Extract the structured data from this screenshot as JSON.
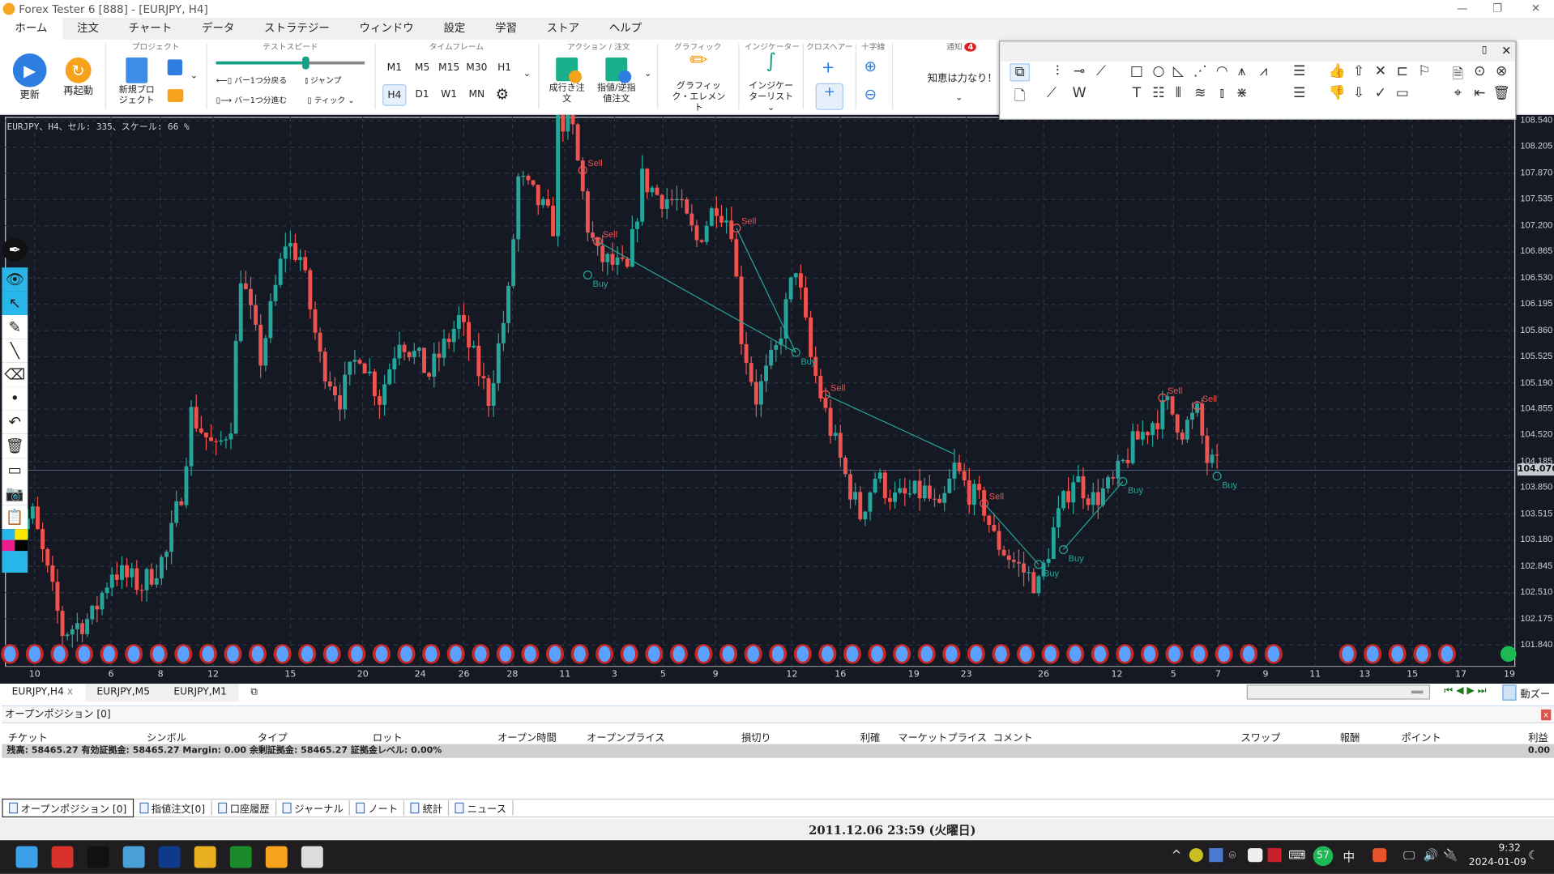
{
  "window": {
    "title": "Forex Tester 6  [888] - [EURJPY, H4]"
  },
  "menu": [
    "ホーム",
    "注文",
    "チャート",
    "データ",
    "ストラテジー",
    "ウィンドウ",
    "設定",
    "学習",
    "ストア",
    "ヘルプ"
  ],
  "ribbon": {
    "refresh": "更新",
    "restart": "再起動",
    "project_group": "プロジェクト",
    "new_project": "新規プロジェクト",
    "speed_group": "テストスピード",
    "speed_value": 0.6,
    "bar_back": "バー1つ分戻る",
    "bar_forward": "バー1つ分進む",
    "jump": "ジャンプ",
    "tick": "ティック",
    "timeframe_group": "タイムフレーム",
    "timeframes": [
      "M1",
      "M5",
      "M15",
      "M30",
      "H1",
      "H4",
      "D1",
      "W1",
      "MN"
    ],
    "selected_timeframe": "H4",
    "action_group": "アクション / 注文",
    "market_order": "成行き注文",
    "limit_order": "指値/逆指値注文",
    "graphic_group": "グラフィック",
    "graphic_elements": "グラフィック・エレメント",
    "indicator_group": "インジケーター",
    "indicator_list": "インジケーターリスト",
    "crosshair_group": "クロスヘアー",
    "cross_group": "十字線",
    "notify_group": "通知",
    "notify_count": "4",
    "notify_message": "知恵は力なり！"
  },
  "drawing_toolbar": {
    "icons": [
      "select-icon",
      "vertical-line-icon",
      "horizontal-line-icon",
      "trend-line-icon",
      "rectangle-icon",
      "ellipse-icon",
      "triangle-icon",
      "fibo-fan-icon",
      "fibo-arc-icon",
      "andrews-pitchfork-icon",
      "zigzag-icon",
      "channel-up-icon",
      "thumbs-up-icon",
      "arrow-up-icon",
      "cross-icon",
      "price-label-icon",
      "flag-icon",
      "template-icon",
      "target-icon",
      "target-x-icon",
      "page-icon",
      "ray-icon",
      "wave-icon",
      "text-icon",
      "parallel-lines-icon",
      "time-lines-icon",
      "fibo-icon",
      "candle-tool-icon",
      "gann-icon",
      "channel-down-icon",
      "thumbs-down-icon",
      "arrow-down-icon",
      "check-icon",
      "price-tag-icon",
      "remove-target-icon",
      "export-icon",
      "trash-icon"
    ]
  },
  "chart": {
    "info": "EURJPY、H4、セル: 335、スケール: 66 %",
    "current_price": "104.076"
  },
  "chart_data": {
    "type": "candlestick",
    "symbol": "EURJPY",
    "timeframe": "H4",
    "ylim": [
      101.7,
      108.6
    ],
    "price_ticks": [
      "108.540",
      "108.205",
      "107.870",
      "107.535",
      "107.200",
      "106.865",
      "106.530",
      "106.195",
      "105.860",
      "105.525",
      "105.190",
      "104.855",
      "104.520",
      "104.185",
      "103.850",
      "103.515",
      "103.180",
      "102.845",
      "102.510",
      "102.175",
      "101.840"
    ],
    "date_ticks": [
      "10",
      "6",
      "8",
      "12",
      "15",
      "20",
      "24",
      "26",
      "28",
      "11",
      "3",
      "5",
      "9",
      "12",
      "16",
      "19",
      "23",
      "26",
      "12",
      "5",
      "7",
      "9",
      "11",
      "13",
      "15",
      "17",
      "19"
    ],
    "close_path_bar_price": [
      [
        0,
        103.2
      ],
      [
        5,
        103.5
      ],
      [
        11,
        102.0
      ],
      [
        17,
        102.2
      ],
      [
        21,
        102.8
      ],
      [
        27,
        102.6
      ],
      [
        32,
        103.0
      ],
      [
        35,
        103.8
      ],
      [
        37,
        104.8
      ],
      [
        42,
        104.3
      ],
      [
        45,
        104.7
      ],
      [
        47,
        106.6
      ],
      [
        51,
        105.5
      ],
      [
        56,
        107.0
      ],
      [
        59,
        106.8
      ],
      [
        63,
        105.5
      ],
      [
        67,
        105.0
      ],
      [
        71,
        105.6
      ],
      [
        75,
        105.0
      ],
      [
        79,
        105.8
      ],
      [
        85,
        105.3
      ],
      [
        91,
        106.0
      ],
      [
        97,
        105.0
      ],
      [
        101,
        106.3
      ],
      [
        103,
        107.8
      ],
      [
        107,
        107.5
      ],
      [
        110,
        107.2
      ],
      [
        111,
        108.6
      ],
      [
        114,
        108.4
      ],
      [
        117,
        107.2
      ],
      [
        119,
        106.8
      ],
      [
        125,
        106.6
      ],
      [
        128,
        107.8
      ],
      [
        131,
        107.6
      ],
      [
        135,
        107.5
      ],
      [
        139,
        107.0
      ],
      [
        143,
        107.5
      ],
      [
        146,
        107.2
      ],
      [
        148,
        105.8
      ],
      [
        151,
        105.0
      ],
      [
        155,
        105.6
      ],
      [
        159,
        106.7
      ],
      [
        162,
        105.5
      ],
      [
        165,
        104.8
      ],
      [
        169,
        104.0
      ],
      [
        172,
        103.5
      ],
      [
        175,
        104.0
      ],
      [
        179,
        103.7
      ],
      [
        185,
        103.8
      ],
      [
        188,
        103.5
      ],
      [
        191,
        104.1
      ],
      [
        194,
        103.8
      ],
      [
        197,
        103.6
      ],
      [
        199,
        103.2
      ],
      [
        203,
        102.9
      ],
      [
        208,
        102.6
      ],
      [
        211,
        103.3
      ],
      [
        215,
        104.0
      ],
      [
        219,
        103.7
      ],
      [
        223,
        103.9
      ],
      [
        227,
        104.4
      ],
      [
        231,
        104.7
      ],
      [
        234,
        104.9
      ],
      [
        237,
        104.6
      ],
      [
        240,
        104.8
      ],
      [
        242,
        104.2
      ],
      [
        244,
        104.1
      ]
    ],
    "trades": [
      {
        "label": "Sell",
        "bar": 116,
        "price": 107.91
      },
      {
        "label": "Sell",
        "bar": 119,
        "price": 107.0
      },
      {
        "label": "Buy",
        "bar": 117,
        "price": 106.57
      },
      {
        "label": "Sell",
        "bar": 147,
        "price": 107.17
      },
      {
        "label": "Buy",
        "bar": 159,
        "price": 105.58
      },
      {
        "label": "Sell",
        "bar": 165,
        "price": 105.04
      },
      {
        "label": "Sell",
        "bar": 197,
        "price": 103.65
      },
      {
        "label": "Buy",
        "bar": 208,
        "price": 102.87
      },
      {
        "label": "Buy",
        "bar": 213,
        "price": 103.06
      },
      {
        "label": "Buy",
        "bar": 225,
        "price": 103.93
      },
      {
        "label": "Sell",
        "bar": 233,
        "price": 105.0
      },
      {
        "label": "Sell",
        "bar": 240,
        "price": 104.9
      },
      {
        "label": "Buy",
        "bar": 244,
        "price": 104.0
      }
    ],
    "trade_links": [
      [
        1,
        4
      ],
      [
        3,
        4
      ],
      [
        5,
        191
      ],
      [
        6,
        7
      ],
      [
        8,
        9
      ]
    ],
    "colors": {
      "up": "#26a69a",
      "down": "#ef5350",
      "background": "#151924"
    }
  },
  "chart_tabs": [
    "EURJPY,H4",
    "EURJPY,M5",
    "EURJPY,M1"
  ],
  "chart_tab_close": "x",
  "auto_scroll": "動ズー",
  "positions": {
    "title": "オープンポジション [0]",
    "columns": [
      "チケット",
      "シンボル",
      "タイプ",
      "ロット",
      "オープン時間",
      "オープンプライス",
      "損切り",
      "利確",
      "マーケットプライス",
      "コメント",
      "スワップ",
      "報酬",
      "ポイント",
      "利益"
    ],
    "summary": "残高: 58465.27 有効証拠金: 58465.27 Margin: 0.00 余剰証拠金: 58465.27 証拠金レベル: 0.00%",
    "total_profit": "0.00",
    "close": "x"
  },
  "bottom_tabs": [
    "オープンポジション [0]",
    "指値注文[0]",
    "口座履歴",
    "ジャーナル",
    "ノート",
    "統計",
    "ニュース"
  ],
  "status": {
    "datetime": "2011.12.06 23:59 (火曜日)"
  },
  "taskbar": {
    "apps": [
      "start-icon",
      "wps-office-icon",
      "zk-app-icon",
      "notepad-icon",
      "teamviewer-icon",
      "chrome-icon",
      "spreadsheet-app-icon",
      "forex-tester-icon",
      "forex-simulator-icon"
    ],
    "tray_badge": "57",
    "ime": "中",
    "time": "9:32",
    "date": "2024-01-09"
  }
}
